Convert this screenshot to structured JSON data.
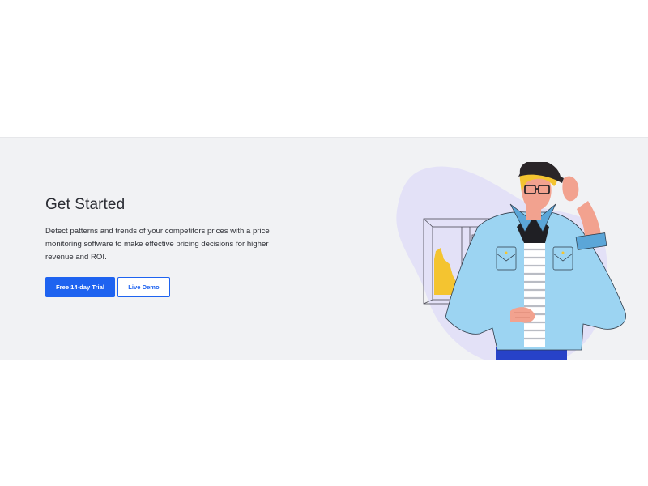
{
  "section": {
    "heading": "Get Started",
    "description": "Detect patterns and trends of your competitors prices with a price monitoring software to make effective pricing decisions for higher revenue and ROI.",
    "primary_button": "Free 14-day Trial",
    "secondary_button": "Live Demo"
  },
  "colors": {
    "band_background": "#f1f2f4",
    "accent": "#1e63f0",
    "blob": "#e3e1f7"
  }
}
